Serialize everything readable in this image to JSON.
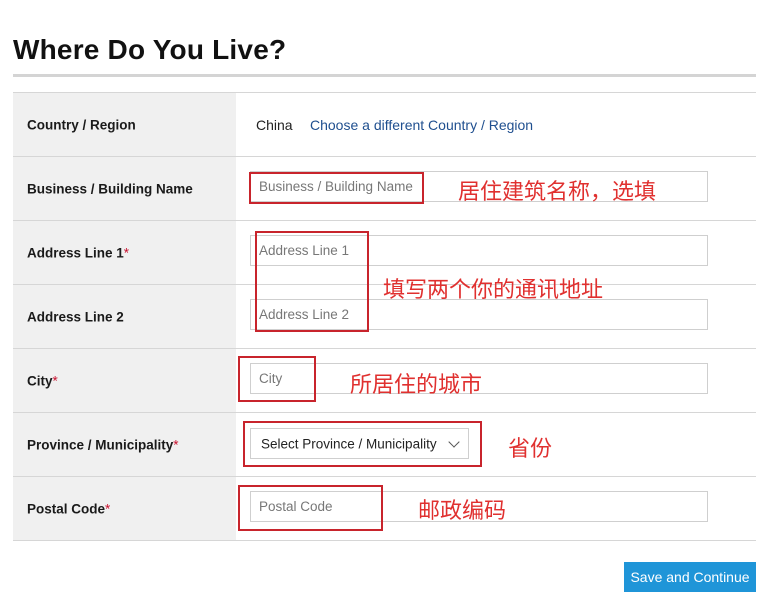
{
  "page": {
    "title": "Where Do You Live?"
  },
  "form": {
    "country": {
      "label": "Country / Region",
      "value": "China",
      "change_link": "Choose a different Country / Region"
    },
    "business": {
      "label": "Business / Building Name",
      "placeholder": "Business / Building Name",
      "value": ""
    },
    "address1": {
      "label": "Address Line 1",
      "required_mark": "*",
      "placeholder": "Address Line 1",
      "value": ""
    },
    "address2": {
      "label": "Address Line 2",
      "placeholder": "Address Line 2",
      "value": ""
    },
    "city": {
      "label": "City",
      "required_mark": "*",
      "placeholder": "City",
      "value": ""
    },
    "province": {
      "label": "Province / Municipality",
      "required_mark": "*",
      "selected": "Select Province / Municipality"
    },
    "postal": {
      "label": "Postal Code",
      "required_mark": "*",
      "placeholder": "Postal Code",
      "value": ""
    }
  },
  "annotations": {
    "business": "居住建筑名称，选填",
    "address": "填写两个你的通讯地址",
    "city": "所居住的城市",
    "province": "省份",
    "postal": "邮政编码"
  },
  "actions": {
    "save_label": "Save and Continue"
  },
  "colors": {
    "annotation_red": "#e0302f",
    "button_blue": "#1f95d8",
    "link_blue": "#1f4f8f",
    "required_red": "#c8102e"
  }
}
